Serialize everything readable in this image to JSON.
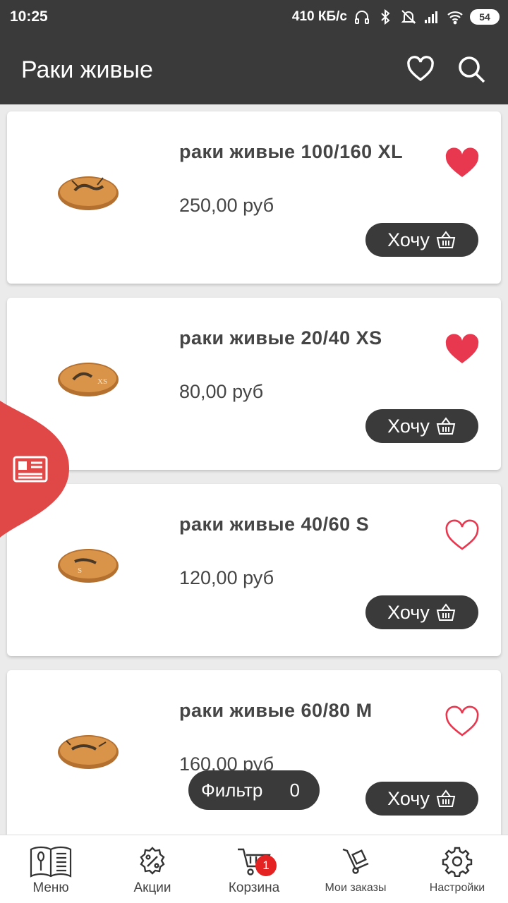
{
  "status_bar": {
    "time": "10:25",
    "speed": "410 КБ/с",
    "battery": "54",
    "icons": [
      "headphones-icon",
      "bluetooth-icon",
      "muted-bell-icon",
      "signal-icon",
      "wifi-icon",
      "battery-icon"
    ]
  },
  "app_bar": {
    "title": "Раки живые",
    "actions": [
      "heart-outline-icon",
      "search-icon"
    ]
  },
  "products": [
    {
      "name": "раки живые 100/160 XL",
      "price": "250,00 руб",
      "favorite": true,
      "button": "Хочу"
    },
    {
      "name": "раки живые 20/40 XS",
      "price": "80,00 руб",
      "favorite": true,
      "button": "Хочу"
    },
    {
      "name": "раки живые 40/60 S",
      "price": "120,00 руб",
      "favorite": false,
      "button": "Хочу"
    },
    {
      "name": "раки живые 60/80 M",
      "price": "160,00 руб",
      "favorite": false,
      "button": "Хочу"
    }
  ],
  "filter": {
    "label": "Фильтр",
    "count": "0"
  },
  "side_tab": {
    "icon": "newspaper-icon"
  },
  "bottom_nav": [
    {
      "label": "Меню",
      "icon": "menu-book-icon"
    },
    {
      "label": "Акции",
      "icon": "percent-gear-icon"
    },
    {
      "label": "Корзина",
      "icon": "cart-icon",
      "badge": "1"
    },
    {
      "label": "Мои заказы",
      "icon": "hand-truck-icon"
    },
    {
      "label": "Настройки",
      "icon": "settings-gear-icon"
    }
  ],
  "colors": {
    "bar": "#3a3a3a",
    "accent_red": "#e8384f",
    "side_tab_red": "#e04848"
  }
}
